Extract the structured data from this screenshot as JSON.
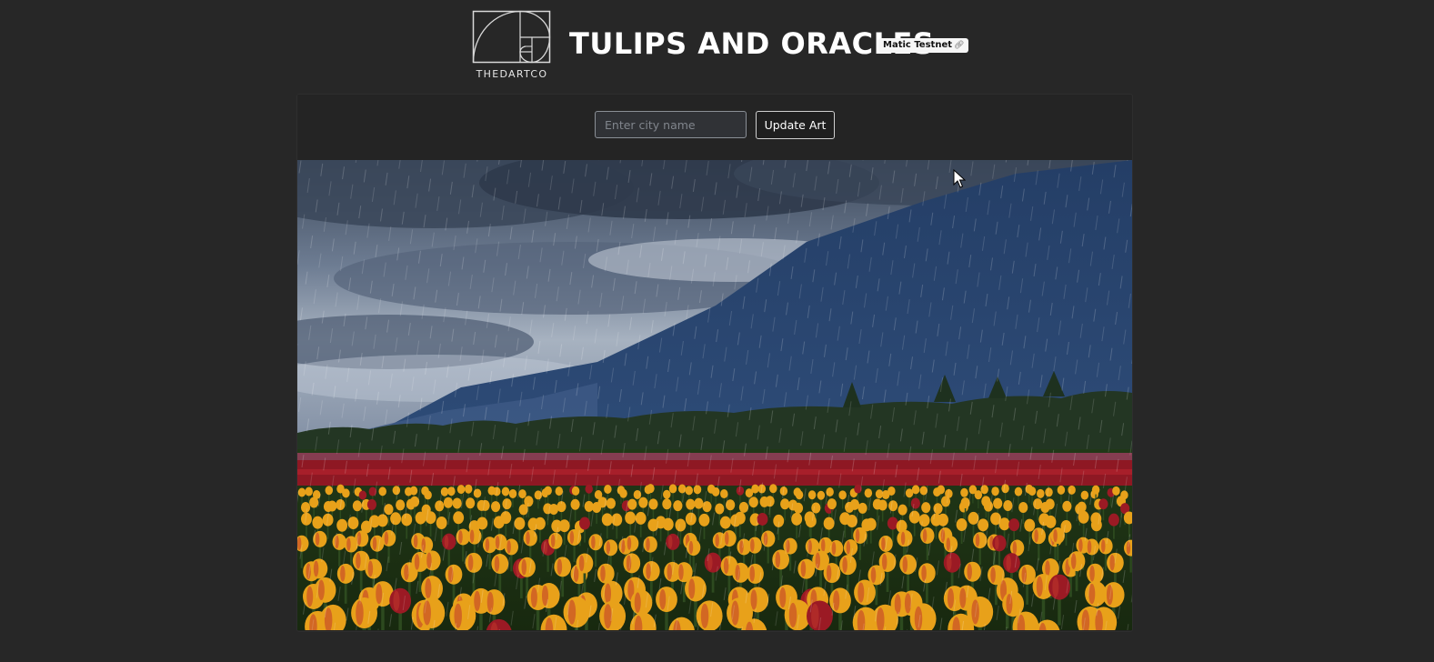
{
  "header": {
    "logo_text": "THEDARTCO",
    "title": "TULIPS AND ORACLES",
    "network_badge": "Matic Testnet",
    "badge_icon": "link-icon"
  },
  "controls": {
    "city_input_placeholder": "Enter city name",
    "city_input_value": "",
    "update_button_label": "Update Art"
  },
  "artwork": {
    "description_icon": "weather-artwork-image",
    "scene_colors": {
      "sky": "#5f6f86",
      "mountain": "#2a4670",
      "trees": "#243a22",
      "red_tulips": "#9b1a24",
      "yellow_tulips": "#e8a11a",
      "stems": "#2d4a1f"
    }
  },
  "colors": {
    "background": "#272727",
    "panel": "#242424",
    "input_bg": "#303236",
    "button_border": "#cfcfcf"
  }
}
